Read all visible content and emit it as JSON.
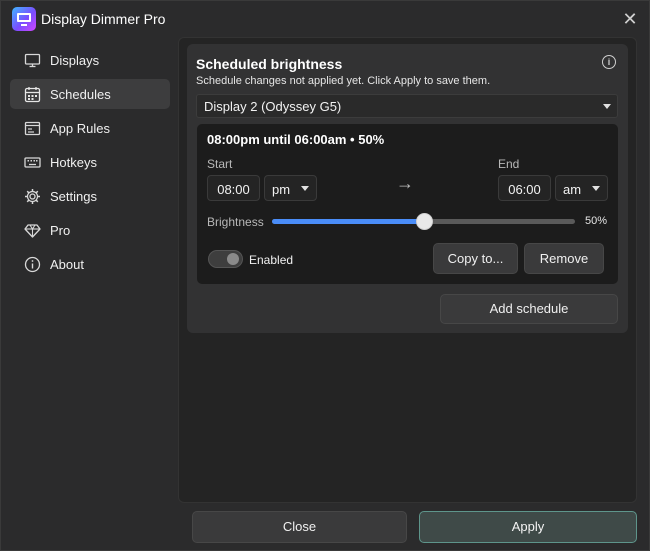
{
  "app": {
    "title": "Display Dimmer Pro",
    "close_glyph": "✕"
  },
  "sidebar": {
    "items": [
      {
        "label": "Displays",
        "icon": "monitor-icon",
        "active": false
      },
      {
        "label": "Schedules",
        "icon": "calendar-icon",
        "active": true
      },
      {
        "label": "App Rules",
        "icon": "app-rules-icon",
        "active": false
      },
      {
        "label": "Hotkeys",
        "icon": "keyboard-icon",
        "active": false
      },
      {
        "label": "Settings",
        "icon": "gear-icon",
        "active": false
      },
      {
        "label": "Pro",
        "icon": "diamond-icon",
        "active": false
      },
      {
        "label": "About",
        "icon": "info-icon",
        "active": false
      }
    ]
  },
  "card": {
    "title": "Scheduled brightness",
    "subtitle": "Schedule changes not applied yet. Click Apply to save them.",
    "display_select": "Display 2 (Odyssey G5)"
  },
  "schedule": {
    "summary": "08:00pm until 06:00am  •  50%",
    "start_label": "Start",
    "start_time": "08:00",
    "start_period": "pm",
    "end_label": "End",
    "end_time": "06:00",
    "end_period": "am",
    "arrow": "→",
    "brightness_label": "Brightness",
    "brightness_percent": 50,
    "brightness_text": "50%",
    "enabled_label": "Enabled",
    "enabled": false,
    "copy_label": "Copy to...",
    "remove_label": "Remove"
  },
  "add_schedule_label": "Add schedule",
  "footer": {
    "close_label": "Close",
    "apply_label": "Apply"
  },
  "colors": {
    "accent": "#4a8df8",
    "apply_border": "#5e958b",
    "window_bg": "#2b2b2c"
  }
}
